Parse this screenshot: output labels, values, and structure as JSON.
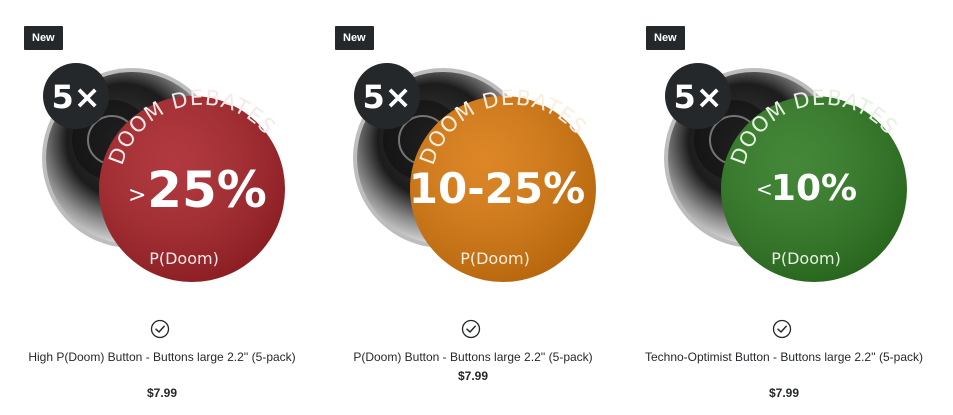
{
  "products": [
    {
      "badge": "New",
      "pack": "5×",
      "brand": "DOOM DEBATES",
      "level_prefix": ">",
      "level": "25%",
      "footer": "P(Doom)",
      "color": "#a82329",
      "title": "High P(Doom) Button - Buttons large 2.2'' (5-pack)",
      "price": "$7.99"
    },
    {
      "badge": "New",
      "pack": "5×",
      "brand": "DOOM DEBATES",
      "level_prefix": "",
      "level": "10-25%",
      "footer": "P(Doom)",
      "color": "#d9790f",
      "title": "P(Doom) Button - Buttons large 2.2'' (5-pack)",
      "price": "$7.99"
    },
    {
      "badge": "New",
      "pack": "5×",
      "brand": "DOOM DEBATES",
      "level_prefix": "<",
      "level": "10%",
      "footer": "P(Doom)",
      "color": "#2f7a22",
      "title": "Techno-Optimist Button - Buttons large 2.2'' (5-pack)",
      "price": "$7.99"
    }
  ]
}
